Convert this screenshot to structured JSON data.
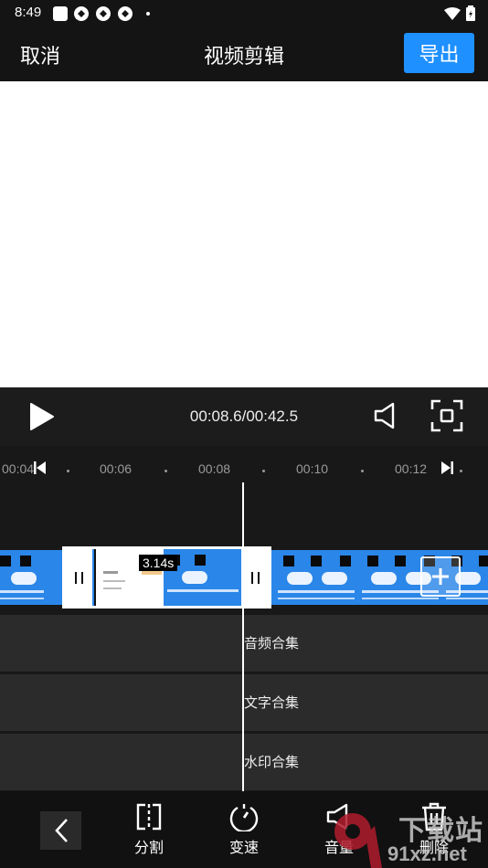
{
  "status_bar": {
    "time": "8:49"
  },
  "header": {
    "cancel_label": "取消",
    "title": "视频剪辑",
    "export_label": "导出"
  },
  "player": {
    "timecode": "00:08.6/00:42.5"
  },
  "timeline": {
    "ruler_labels": [
      "00:04",
      "00:06",
      "00:08",
      "00:10",
      "00:12"
    ],
    "selected_clip_duration": "3.14s",
    "tracks": [
      "音频合集",
      "文字合集",
      "水印合集"
    ]
  },
  "toolbar": {
    "split_label": "分割",
    "speed_label": "变速",
    "volume_label": "音量",
    "delete_label": "删除"
  },
  "watermark": {
    "line1": "下载站",
    "line2": "91xz.net"
  },
  "colors": {
    "accent": "#1e90ff",
    "clip_bg": "#2a86e8",
    "background": "#141414"
  }
}
